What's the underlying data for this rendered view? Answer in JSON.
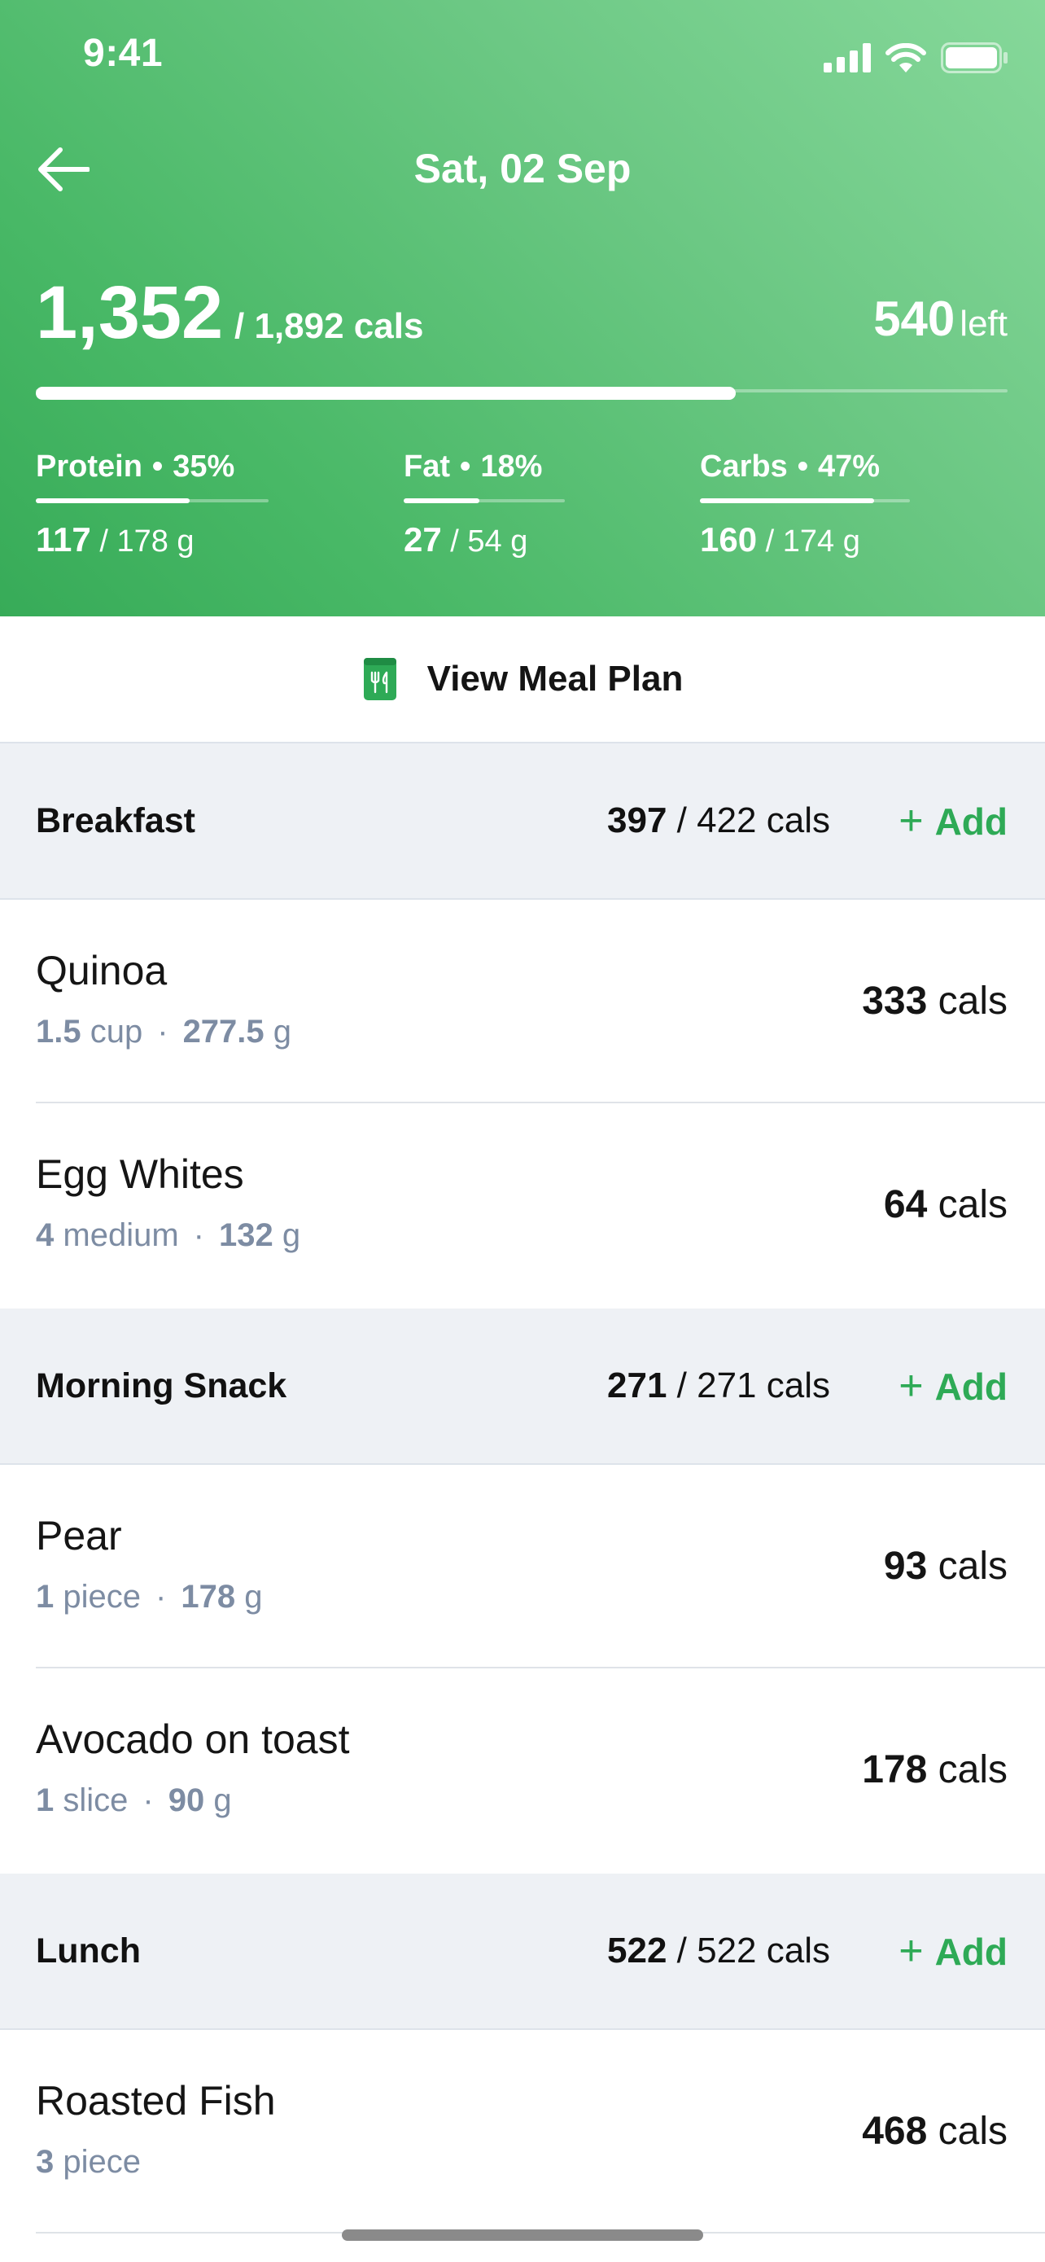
{
  "status_bar": {
    "time": "9:41"
  },
  "header": {
    "date": "Sat, 02 Sep",
    "calories": {
      "consumed": "1,352",
      "goal_text": "/ 1,892 cals",
      "left_value": "540",
      "left_label": "left",
      "progress": 0.72
    },
    "macros": [
      {
        "name": "Protein",
        "percent": "35%",
        "value": "117",
        "goal": "/ 178 g",
        "progress": 0.66
      },
      {
        "name": "Fat",
        "percent": "18%",
        "value": "27",
        "goal": "/ 54 g",
        "progress": 0.47
      },
      {
        "name": "Carbs",
        "percent": "47%",
        "value": "160",
        "goal": "/ 174 g",
        "progress": 0.83
      }
    ]
  },
  "meal_plan": {
    "label": "View Meal Plan",
    "icon": "meal-plan-icon"
  },
  "meals": [
    {
      "title": "Breakfast",
      "consumed": "397",
      "goal": "/ 422 cals",
      "add_plus": "+",
      "add_label": "Add"
    },
    {
      "title": "Morning Snack",
      "consumed": "271",
      "goal": "/ 271 cals",
      "add_plus": "+",
      "add_label": "Add"
    },
    {
      "title": "Lunch",
      "consumed": "522",
      "goal": "/ 522 cals",
      "add_plus": "+",
      "add_label": "Add"
    }
  ],
  "foods": [
    {
      "name": "Quinoa",
      "qty": "1.5",
      "unit": "cup",
      "dot": "·",
      "weight_value": "277.5",
      "weight_unit": "g",
      "cal_value": "333",
      "cal_unit": "cals"
    },
    {
      "name": "Egg Whites",
      "qty": "4",
      "unit": "medium",
      "dot": "·",
      "weight_value": "132",
      "weight_unit": "g",
      "cal_value": "64",
      "cal_unit": "cals"
    },
    {
      "name": "Pear",
      "qty": "1",
      "unit": "piece",
      "dot": "·",
      "weight_value": "178",
      "weight_unit": "g",
      "cal_value": "93",
      "cal_unit": "cals"
    },
    {
      "name": "Avocado on toast",
      "qty": "1",
      "unit": "slice",
      "dot": "·",
      "weight_value": "90",
      "weight_unit": "g",
      "cal_value": "178",
      "cal_unit": "cals"
    },
    {
      "name": "Roasted Fish",
      "qty": "3",
      "unit": "piece",
      "cal_value": "468",
      "cal_unit": "cals"
    }
  ],
  "colors": {
    "accent": "#2eaa56",
    "header_start": "#37ab58",
    "header_end": "#86d89a",
    "muted_text": "#7d8ca3",
    "section_bg": "#eef1f5"
  }
}
